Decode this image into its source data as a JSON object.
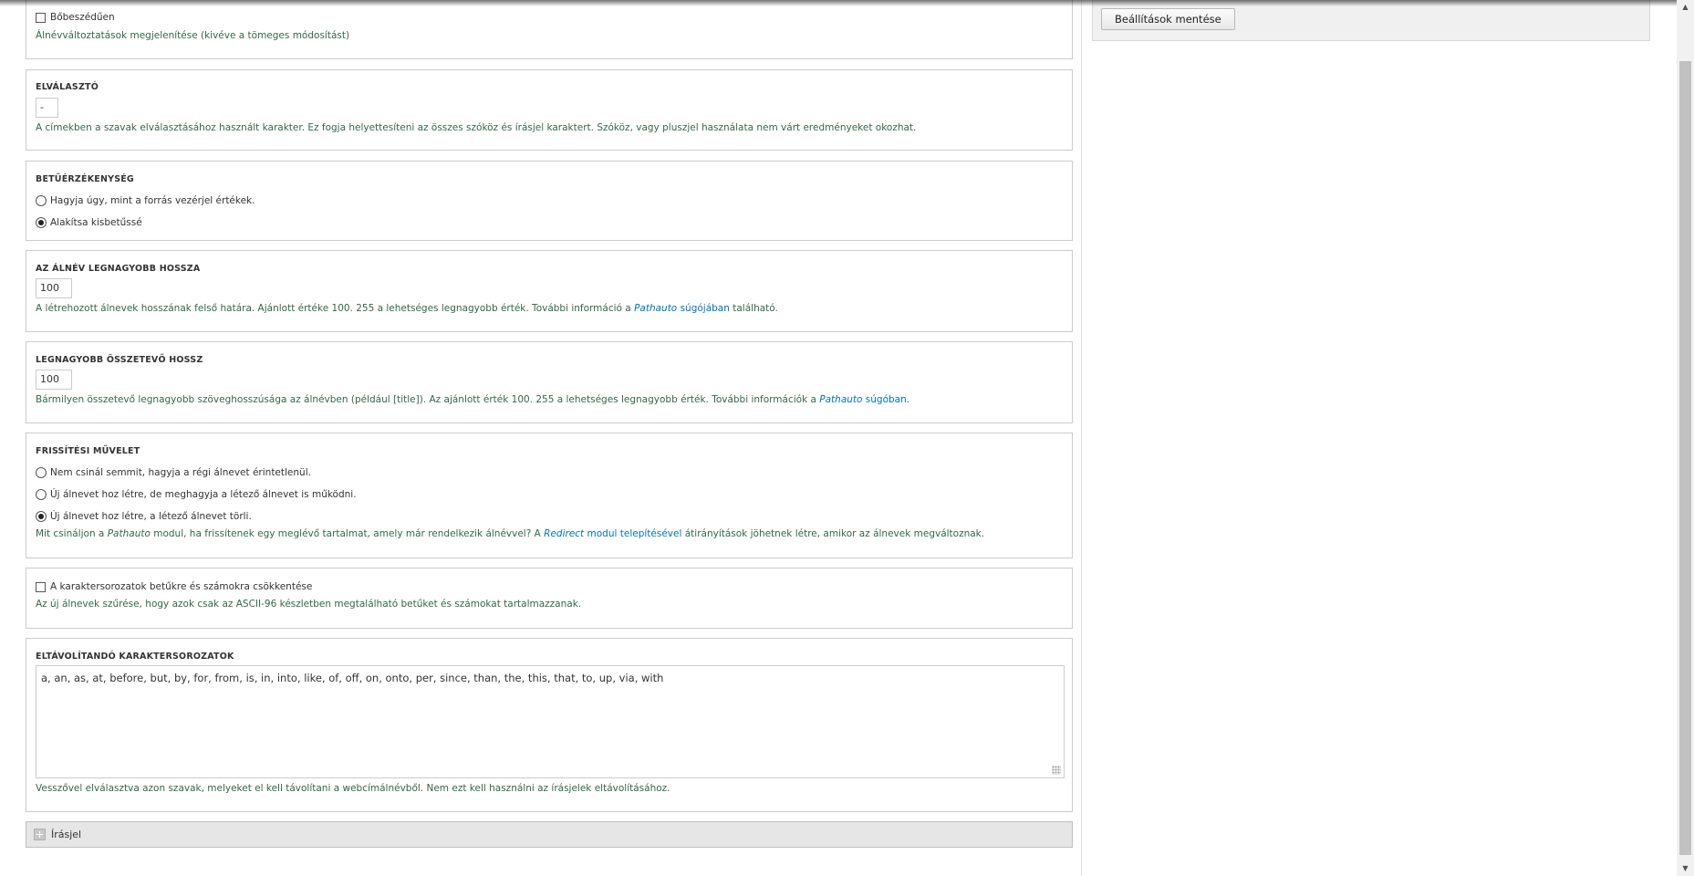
{
  "verbose": {
    "checkbox_label": "Bőbeszédűen",
    "description": "Álnévváltoztatások megjelenítése (kivéve a tömeges módosítást)"
  },
  "separator": {
    "legend": "ELVÁLASZTÓ",
    "value": "-",
    "description": "A címekben a szavak elválasztásához használt karakter. Ez fogja helyettesíteni az összes szóköz és írásjel karaktert. Szóköz, vagy pluszjel használata nem várt eredményeket okozhat."
  },
  "case": {
    "legend": "BETŰÉRZÉKENYSÉG",
    "options": [
      {
        "label": "Hagyja úgy, mint a forrás vezérjel értékek.",
        "checked": false
      },
      {
        "label": "Alakítsa kisbetűssé",
        "checked": true
      }
    ]
  },
  "max_length": {
    "legend": "AZ ÁLNÉV LEGNAGYOBB HOSSZA",
    "value": "100",
    "desc_before": "A létrehozott álnevek hosszának felső határa. Ajánlott értéke 100. 255 a lehetséges legnagyobb érték. További információ a ",
    "desc_link_em": "Pathauto",
    "desc_link_rest": " súgójában",
    "desc_after": " található."
  },
  "max_component": {
    "legend": "LEGNAGYOBB ÖSSZETEVŐ HOSSZ",
    "value": "100",
    "desc_before": "Bármilyen összetevő legnagyobb szöveghosszúsága az álnévben (például [title]). Az ajánlott érték 100. 255 a lehetséges legnagyobb érték. További információk a ",
    "desc_link_em": "Pathauto",
    "desc_link_rest": " súgóban",
    "desc_after": "."
  },
  "update_action": {
    "legend": "FRISSÍTÉSI MŰVELET",
    "options": [
      {
        "label": "Nem csinál semmit, hagyja a régi álnevet érintetlenül.",
        "checked": false
      },
      {
        "label": "Új álnevet hoz létre, de meghagyja a létező álnevet is működni.",
        "checked": false
      },
      {
        "label": "Új álnevet hoz létre, a létező álnevet törli.",
        "checked": true
      }
    ],
    "desc_1": "Mit csináljon a ",
    "desc_em_1": "Pathauto",
    "desc_2": " modul, ha frissítenek egy meglévő tartalmat, amely már rendelkezik álnévvel? A ",
    "desc_link_em": "Redirect",
    "desc_link_rest": " modul telepítésével",
    "desc_3": " átirányítások jöhetnek létre, amikor az álnevek megváltoznak."
  },
  "transliterate": {
    "checkbox_label": "A karaktersorozatok betűkre és számokra csökkentése",
    "description": "Az új álnevek szűrése, hogy azok csak az ASCII-96 készletben megtalálható betűket és számokat tartalmazzanak."
  },
  "ignore_words": {
    "legend": "ELTÁVOLÍTANDÓ KARAKTERSOROZATOK",
    "value": "a, an, as, at, before, but, by, for, from, is, in, into, like, of, off, on, onto, per, since, than, the, this, that, to, up, via, with",
    "description": "Vesszővel elválasztva azon szavak, melyeket el kell távolítani a webcímálnévből. Nem ezt kell használni az írásjelek eltávolításához."
  },
  "punctuation": {
    "label": "Írásjel"
  },
  "sidebar": {
    "save_label": "Beállítások mentése"
  },
  "scrollbar": {
    "up_arrow": "▲",
    "down_arrow": "▼"
  }
}
